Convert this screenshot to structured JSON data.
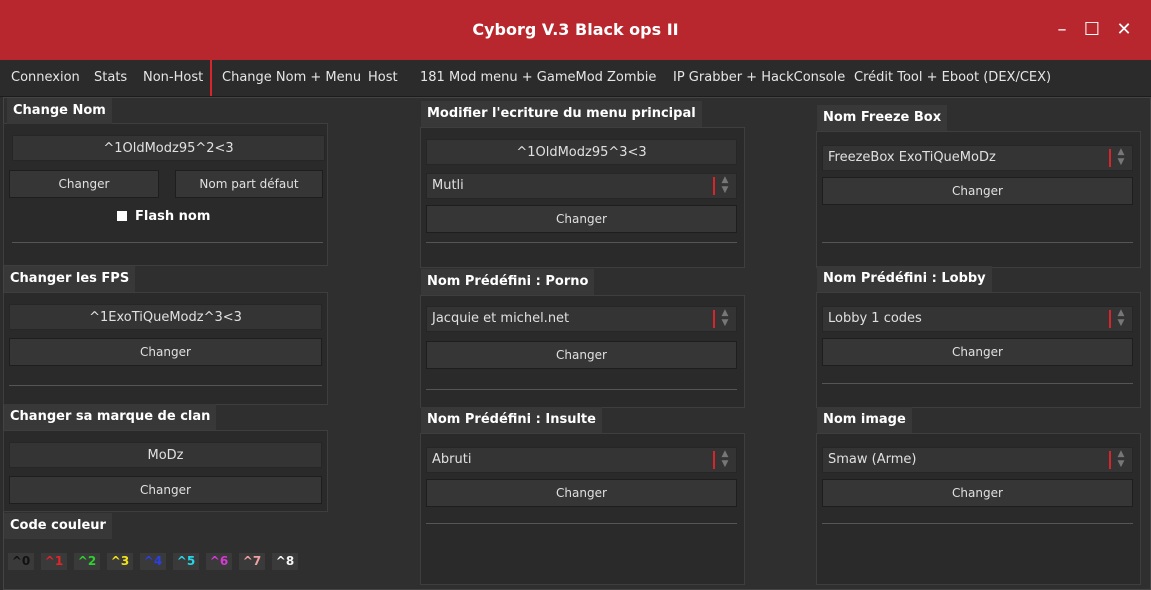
{
  "window": {
    "title": "Cyborg V.3 Black ops II",
    "minimize": "–",
    "maximize": "☐",
    "close": "✕"
  },
  "tabs": [
    "Connexion",
    "Stats",
    "Non-Host",
    "Change Nom + Menu",
    "Host",
    "181 Mod menu + GameMod",
    "Zombie",
    "IP Grabber + HackConsole",
    "Crédit Tool + Eboot (DEX/CEX)"
  ],
  "change_nom": {
    "label": "Change Nom",
    "value": "^1OldModz95^2<3",
    "change_button": "Changer",
    "default_button": "Nom part défaut",
    "flash_label": "Flash nom"
  },
  "fps": {
    "label": "Changer les FPS",
    "value": "^1ExoTiQueModz^3<3",
    "button": "Changer"
  },
  "clan": {
    "label": "Changer sa marque de clan",
    "value": "MoDz",
    "button": "Changer"
  },
  "code_couleur": {
    "label": "Code couleur",
    "swatches": [
      {
        "text": "^0",
        "color": "#111111"
      },
      {
        "text": "^1",
        "color": "#e2242b"
      },
      {
        "text": "^2",
        "color": "#2ed12e"
      },
      {
        "text": "^3",
        "color": "#f2e21a"
      },
      {
        "text": "^4",
        "color": "#2c3fe0"
      },
      {
        "text": "^5",
        "color": "#27d6e6"
      },
      {
        "text": "^6",
        "color": "#d63ad6"
      },
      {
        "text": "^7",
        "color": "#f0a0a0"
      },
      {
        "text": "^8",
        "color": "#f5f5f5"
      }
    ]
  },
  "menu_principal": {
    "label": "Modifier l'ecriture du menu principal",
    "value": "^1OldModz95^3<3",
    "combo": "Mutli",
    "button": "Changer"
  },
  "porno": {
    "label": "Nom Prédéfini : Porno",
    "combo": "Jacquie et michel.net",
    "button": "Changer"
  },
  "insulte": {
    "label": "Nom Prédéfini : Insulte",
    "combo": "Abruti",
    "button": "Changer"
  },
  "freeze": {
    "label": "Nom Freeze Box",
    "combo": "FreezeBox ExoTiQueMoDz",
    "button": "Changer"
  },
  "lobby": {
    "label": "Nom Prédéfini : Lobby",
    "combo": "Lobby 1 codes",
    "button": "Changer"
  },
  "image": {
    "label": "Nom image",
    "combo": "Smaw (Arme)",
    "button": "Changer"
  },
  "colors": {
    "titlebar": "#b8272d",
    "accent": "#d8252c"
  }
}
